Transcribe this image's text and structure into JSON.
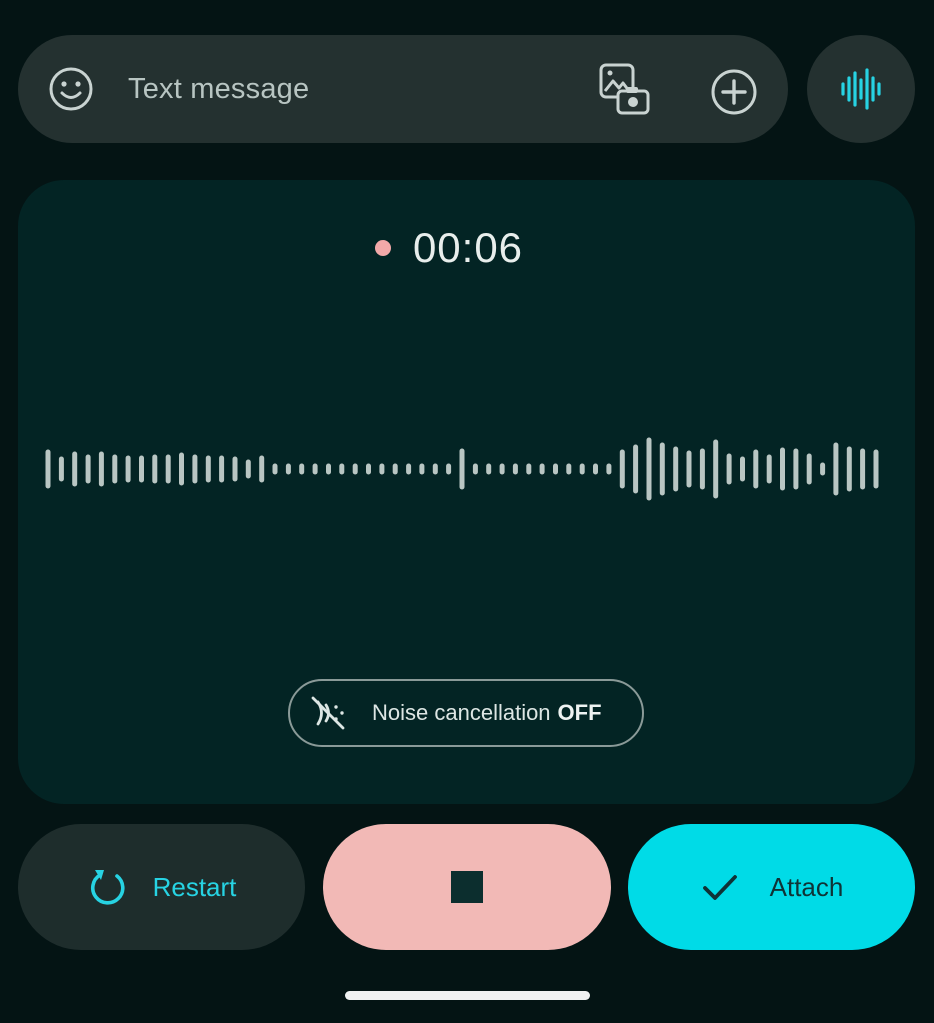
{
  "compose": {
    "placeholder": "Text message",
    "emoji_icon": "emoji-smile-icon",
    "gallery_icon": "gallery-camera-icon",
    "plus_icon": "add-circle-icon",
    "voice_icon": "voice-waveform-icon"
  },
  "recorder": {
    "timer": "00:06",
    "recording_indicator_color": "#f2a9a9",
    "waveform_color": "#b9c6c3",
    "noise_cancellation": {
      "label": "Noise cancellation",
      "state": "OFF",
      "icon": "noise-cancellation-off-icon"
    }
  },
  "actions": {
    "restart_label": "Restart",
    "restart_icon": "restart-icon",
    "stop_icon": "stop-icon",
    "attach_label": "Attach",
    "attach_icon": "check-icon"
  },
  "colors": {
    "accent": "#27d3e3",
    "attach_bg": "#00dbe7",
    "stop_bg": "#f2b9b6",
    "panel_bg": "#032424",
    "compose_bg": "#243130"
  }
}
